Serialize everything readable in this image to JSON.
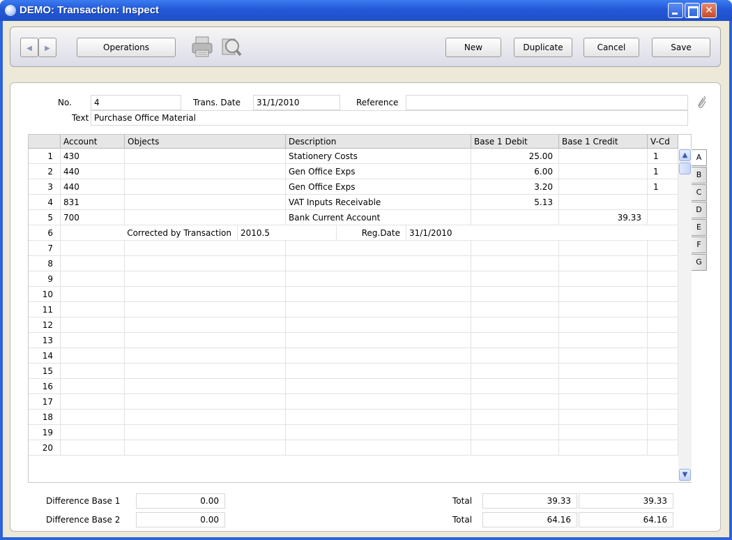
{
  "window": {
    "title": "DEMO: Transaction: Inspect",
    "controls": [
      "minimize-icon",
      "maximize-icon",
      "close-icon"
    ]
  },
  "toolbar": {
    "prev_icon": "prev-record-icon",
    "next_icon": "next-record-icon",
    "operations_label": "Operations",
    "print_icon": "printer-icon",
    "preview_icon": "print-preview-icon",
    "new_label": "New",
    "duplicate_label": "Duplicate",
    "cancel_label": "Cancel",
    "save_label": "Save"
  },
  "header": {
    "no_label": "No.",
    "no_value": "4",
    "trans_date_label": "Trans. Date",
    "trans_date_value": "31/1/2010",
    "reference_label": "Reference",
    "reference_value": "",
    "text_label": "Text",
    "text_value": "Purchase Office Material",
    "attachment_icon": "paperclip-icon"
  },
  "grid": {
    "columns": [
      "",
      "Account",
      "Objects",
      "Description",
      "Base 1 Debit",
      "Base 1 Credit",
      "V-Cd"
    ],
    "rows": [
      {
        "n": "1",
        "account": "430",
        "objects": "",
        "description": "Stationery Costs",
        "debit": "25.00",
        "credit": "",
        "vcd": "1"
      },
      {
        "n": "2",
        "account": "440",
        "objects": "",
        "description": "Gen Office Exps",
        "debit": "6.00",
        "credit": "",
        "vcd": "1"
      },
      {
        "n": "3",
        "account": "440",
        "objects": "",
        "description": "Gen Office Exps",
        "debit": "3.20",
        "credit": "",
        "vcd": "1"
      },
      {
        "n": "4",
        "account": "831",
        "objects": "",
        "description": "VAT Inputs Receivable",
        "debit": "5.13",
        "credit": "",
        "vcd": ""
      },
      {
        "n": "5",
        "account": "700",
        "objects": "",
        "description": "Bank Current Account",
        "debit": "",
        "credit": "39.33",
        "vcd": ""
      }
    ],
    "info_row": {
      "n": "6",
      "corrected_label": "Corrected by Transaction",
      "corrected_value": "2010.5",
      "regdate_label": "Reg.Date",
      "regdate_value": "31/1/2010"
    },
    "empty_row_numbers": [
      "7",
      "8",
      "9",
      "10",
      "11",
      "12",
      "13",
      "14",
      "15",
      "16",
      "17",
      "18",
      "19",
      "20"
    ]
  },
  "tabs": [
    "A",
    "B",
    "C",
    "D",
    "E",
    "F",
    "G"
  ],
  "active_tab": "A",
  "footer": {
    "diff1_label": "Difference Base 1",
    "diff1_value": "0.00",
    "diff2_label": "Difference Base 2",
    "diff2_value": "0.00",
    "total_label": "Total",
    "total1_debit": "39.33",
    "total1_credit": "39.33",
    "total2_debit": "64.16",
    "total2_credit": "64.16"
  },
  "colors": {
    "titlebar": "#2358d8",
    "window_bg": "#ece9d8",
    "header_cell": "#e6e6e6"
  }
}
